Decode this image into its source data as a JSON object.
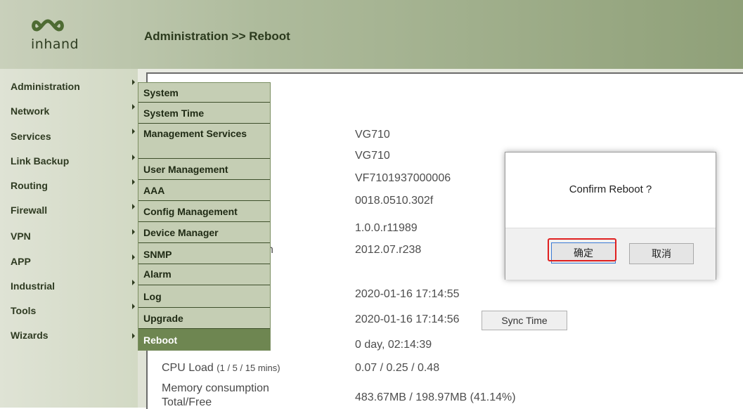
{
  "header": {
    "logo_text": "inhand",
    "breadcrumb": "Administration >> Reboot"
  },
  "sidebar": {
    "items": [
      {
        "label": "Administration"
      },
      {
        "label": "Network"
      },
      {
        "label": "Services"
      },
      {
        "label": "Link Backup"
      },
      {
        "label": "Routing"
      },
      {
        "label": "Firewall"
      },
      {
        "label": "VPN"
      },
      {
        "label": "APP"
      },
      {
        "label": "Industrial"
      },
      {
        "label": "Tools"
      },
      {
        "label": "Wizards"
      }
    ]
  },
  "submenu": {
    "items": [
      {
        "label": "System"
      },
      {
        "label": "System Time"
      },
      {
        "label": "Management Services"
      },
      {
        "label": "User Management"
      },
      {
        "label": "AAA"
      },
      {
        "label": "Config Management"
      },
      {
        "label": "Device Manager"
      },
      {
        "label": "SNMP"
      },
      {
        "label": "Alarm"
      },
      {
        "label": "Log"
      },
      {
        "label": "Upgrade"
      },
      {
        "label": "Reboot"
      }
    ],
    "active": "Reboot"
  },
  "status": {
    "partial_label_fragment": "n",
    "values": [
      "VG710",
      "VG710",
      "VF7101937000006",
      "0018.0510.302f",
      "1.0.0.r11989",
      "2012.07.r238",
      "2020-01-16 17:14:55",
      "2020-01-16 17:14:56",
      "0 day, 02:14:39",
      "0.07 / 0.25 / 0.48",
      "483.67MB / 198.97MB (41.14%)"
    ],
    "cpu_label": "CPU Load",
    "cpu_sub": "(1 / 5 / 15 mins)",
    "mem_label_1": "Memory consumption",
    "mem_label_2": "Total/Free",
    "sync_button": "Sync Time"
  },
  "dialog": {
    "message": "Confirm Reboot ?",
    "ok_label": "确定",
    "cancel_label": "取消"
  },
  "colors": {
    "highlight": "#e02020",
    "active_menu": "#6e8651"
  }
}
